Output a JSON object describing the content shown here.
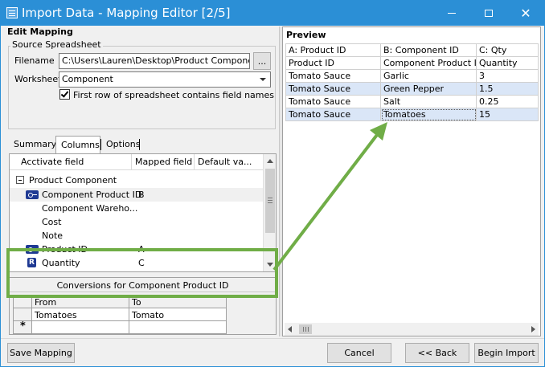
{
  "window": {
    "title": "Import Data - Mapping Editor [2/5]",
    "colors": {
      "titlebar": "#2b8fd6",
      "highlight_row": "#dae6f7",
      "annotation": "#70ad47",
      "icon_blue": "#1f3a93"
    }
  },
  "edit_mapping": {
    "heading": "Edit Mapping",
    "source_group": "Source Spreadsheet",
    "filename_label": "Filename",
    "filename_value": "C:\\Users\\Lauren\\Desktop\\Product Components.x",
    "browse_label": "...",
    "worksheet_label": "Worksheet",
    "worksheet_value": "Component",
    "first_row_label": "First row of spreadsheet contains field names",
    "first_row_checked": true
  },
  "tabs": [
    {
      "label": "Summary",
      "active": false
    },
    {
      "label": "Columns",
      "active": true
    },
    {
      "label": "Options",
      "active": false
    }
  ],
  "field_grid": {
    "headers": [
      "Acctivate field",
      "Mapped field",
      "Default va..."
    ],
    "group_label": "Product Component",
    "rows": [
      {
        "field": "Component Product ID",
        "mapped": "B",
        "icon": "key-icon"
      },
      {
        "field": "Component Wareho...",
        "mapped": "",
        "icon": ""
      },
      {
        "field": "Cost",
        "mapped": "",
        "icon": ""
      },
      {
        "field": "Note",
        "mapped": "",
        "icon": ""
      },
      {
        "field": "Product ID",
        "mapped": "A",
        "icon": "key-icon"
      },
      {
        "field": "Quantity",
        "mapped": "C",
        "icon": "required-icon",
        "icon_text": "R"
      }
    ]
  },
  "conversions": {
    "title": "Conversions for Component Product ID",
    "headers": [
      "From",
      "To"
    ],
    "rows": [
      {
        "from": "Tomatoes",
        "to": "Tomato"
      }
    ],
    "new_row_marker": "*"
  },
  "preview": {
    "heading": "Preview",
    "column_headers": [
      "A: Product ID",
      "B: Component ID",
      "C: Qty"
    ],
    "rows": [
      [
        "Product ID",
        "Component Product ID",
        "Quantity"
      ],
      [
        "Tomato Sauce",
        "Garlic",
        "3"
      ],
      [
        "Tomato Sauce",
        "Green Pepper",
        "1.5"
      ],
      [
        "Tomato Sauce",
        "Salt",
        "0.25"
      ],
      [
        "Tomato Sauce",
        "Tomatoes",
        "15"
      ]
    ]
  },
  "buttons": {
    "save_mapping": "Save Mapping",
    "cancel": "Cancel",
    "back": "<< Back",
    "begin_import": "Begin Import"
  }
}
